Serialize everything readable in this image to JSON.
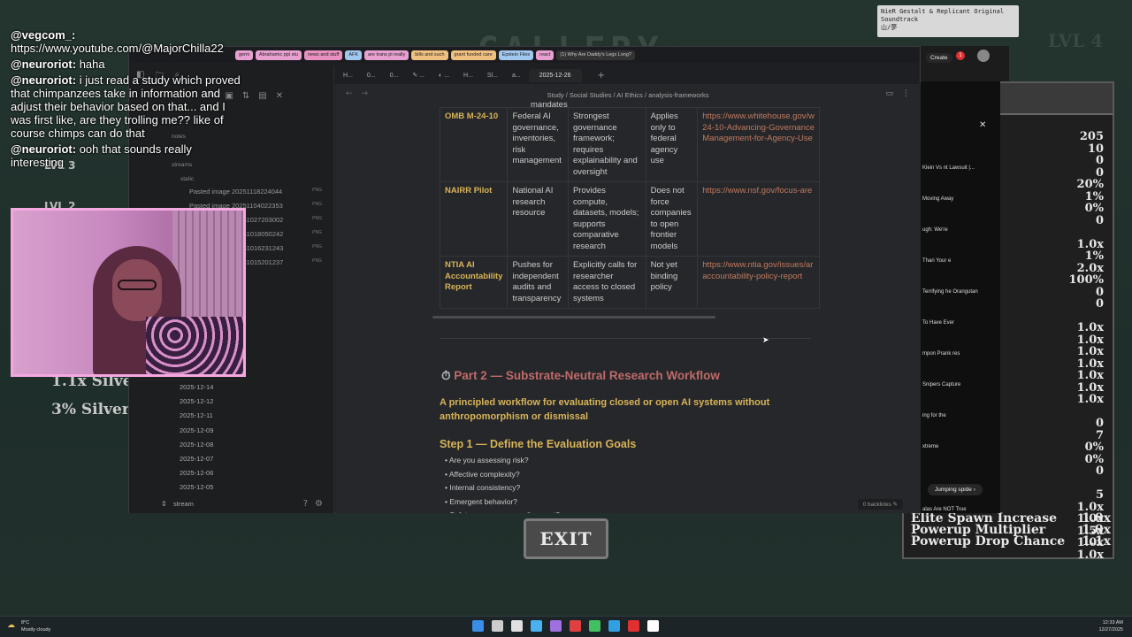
{
  "game": {
    "title": "GALLERY",
    "lvl_top": "LVL 4",
    "exit_label": "EXIT",
    "music_box": "NieR Gestalt & Replicant Original Soundtrack",
    "music_sub": "山/夢",
    "lvl_side": [
      "LVL 3",
      "LVL 2"
    ],
    "silver_rows": [
      "1.1x Silver",
      "3% Silver"
    ],
    "stat_values": [
      "205",
      "10",
      "0",
      "0",
      "20%",
      "1%",
      "0%",
      "0",
      "",
      "1.0x",
      "1%",
      "2.0x",
      "100%",
      "0",
      "0",
      "",
      "1.0x",
      "1.0x",
      "1.0x",
      "1.0x",
      "1.0x",
      "1.0x",
      "1.0x",
      "",
      "0",
      "7",
      "0%",
      "0%",
      "0",
      "",
      "5",
      "1.0x",
      "1.0x",
      "1.5x",
      "1.0x",
      "1.0x"
    ],
    "stat_footer": [
      {
        "label": "Elite Spawn Increase",
        "value": "1.0x"
      },
      {
        "label": "Powerup Multiplier",
        "value": "1.0x"
      },
      {
        "label": "Powerup Drop Chance",
        "value": "1.1x"
      }
    ]
  },
  "chat": [
    {
      "user": "@vegcom_:",
      "text": "https://www.youtube.com/@MajorChilla22"
    },
    {
      "user": "@neuroriot:",
      "text": "haha"
    },
    {
      "user": "@neuroriot:",
      "text": "i just read a study which proved that chimpanzees take in information and adjust their behavior based on that... and I was first like, are they trolling me?? like of course chimps can do that"
    },
    {
      "user": "@neuroriot:",
      "text": "ooh that sounds really interesting"
    }
  ],
  "browser_tabs": [
    {
      "label": "gemi",
      "color": "#e8a0d0"
    },
    {
      "label": "Abrahamic ppl stu",
      "color": "#e8a0d0"
    },
    {
      "label": "news and stuff",
      "color": "#e890c0"
    },
    {
      "label": "AFK",
      "color": "#a0c8f0"
    },
    {
      "label": "are trans pl really",
      "color": "#e8a0d0"
    },
    {
      "label": "bills and such",
      "color": "#f0c080"
    },
    {
      "label": "grant funded care",
      "color": "#f0c080"
    },
    {
      "label": "Epstein Files",
      "color": "#a0c8f0"
    },
    {
      "label": "react",
      "color": "#e8a0d0"
    },
    {
      "label": "(1) Why Are Daddy's Legs Long?",
      "color": ""
    }
  ],
  "obsidian_tabs": [
    "H...",
    "0...",
    "0...",
    "✎ ...",
    "◐ ...",
    "H...",
    "Sl...",
    "a...",
    "2025-12-26"
  ],
  "breadcrumb": "Study / Social Studies / AI Ethics / analysis-frameworks",
  "sidebar": {
    "folder_labels": [
      "notes",
      "streams",
      "static"
    ],
    "files": [
      {
        "name": "Pasted image 20251118224044",
        "ext": "PNG"
      },
      {
        "name": "Pasted image 20251104022353",
        "ext": "PNG"
      },
      {
        "name": "Pasted image 20251027203002",
        "ext": "PNG"
      },
      {
        "name": "Pasted image 20251018050242",
        "ext": "PNG"
      },
      {
        "name": "Pasted image 20251016231243",
        "ext": "PNG"
      },
      {
        "name": "Pasted image 20251015201237",
        "ext": "PNG"
      }
    ],
    "dates": [
      "2025-12-14",
      "2025-12-12",
      "2025-12-11",
      "2025-12-09",
      "2025-12-08",
      "2025-12-07",
      "2025-12-06",
      "2025-12-05"
    ],
    "footer_label": "stream"
  },
  "table": {
    "top_fragment": "mandates",
    "rows": [
      {
        "name": "OMB M-24-10",
        "c2": "Federal AI governance, inventories, risk management",
        "c3": "Strongest governance framework; requires explainability and oversight",
        "c4": "Applies only to federal agency use",
        "link": "https://www.whitehouse.gov/w 24-10-Advancing-Governance Management-for-Agency-Use"
      },
      {
        "name": "NAIRR Pilot",
        "c2": "National AI research resource",
        "c3": "Provides compute, datasets, models; supports comparative research",
        "c4": "Does not force companies to open frontier models",
        "link": "https://www.nsf.gov/focus-are"
      },
      {
        "name": "NTIA AI Accountability Report",
        "c2": "Pushes for independent audits and transparency",
        "c3": "Explicitly calls for researcher access to closed systems",
        "c4": "Not yet binding policy",
        "link": "https://www.ntia.gov/issues/ar accountability-policy-report"
      }
    ]
  },
  "doc": {
    "part_heading": "Part 2 — Substrate-Neutral Research Workflow",
    "lead": "A principled workflow for evaluating closed or open AI systems without anthropomorphism or dismissal",
    "step_heading": "Step 1 — Define the Evaluation Goals",
    "bullets": [
      "Are you assessing risk?",
      "Affective complexity?",
      "Internal consistency?",
      "Emergent behavior?",
      "Safety or governance alignment?"
    ],
    "backlinks": "0 backlinks"
  },
  "youtube": {
    "create": "Create",
    "notif_count": "1",
    "items": [
      "Klein Vs nt Lawsuit |...",
      "Moving Away",
      "ugh: We're",
      "Than Your e",
      "Terrifying he Orangutan",
      "To Have Ever",
      "mpon Prank res",
      "Snipers Capture",
      "ing for the",
      "xtreme",
      "alas Are NOT True"
    ],
    "chip": "Jumping spide"
  },
  "taskbar": {
    "temp": "8°C",
    "weather": "Mostly cloudy",
    "time": "12:33 AM",
    "date": "12/27/2025",
    "icon_colors": [
      "#3a8ee6",
      "#cccccc",
      "#e0e0e0",
      "#4ab0f0",
      "#a070e0",
      "#e04040",
      "#40c060",
      "#30a0e0",
      "#e03030",
      "#ffffff"
    ]
  }
}
